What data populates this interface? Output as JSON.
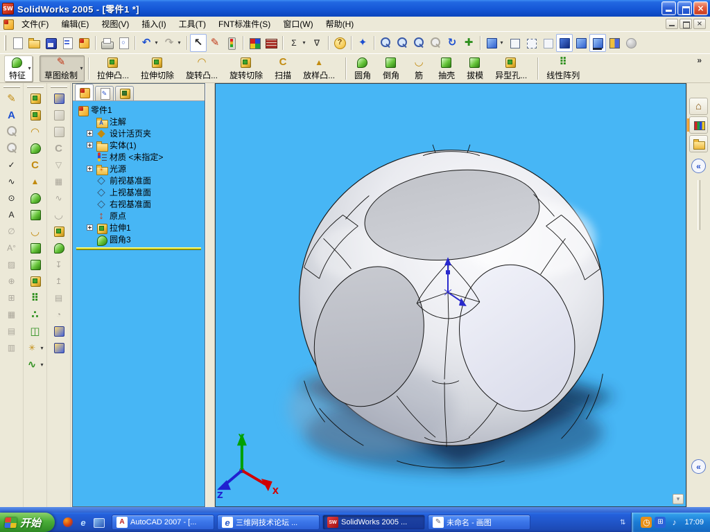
{
  "titlebar": {
    "logo": "SW",
    "title": "SolidWorks 2005 - [零件1 *]",
    "controls": [
      {
        "name": "minimize-button",
        "c": "wmin"
      },
      {
        "name": "restore-button",
        "c": "wres"
      },
      {
        "name": "close-button",
        "c": "wclose",
        "g": "×"
      }
    ]
  },
  "menubar": {
    "items": [
      "文件(F)",
      "编辑(E)",
      "视图(V)",
      "插入(I)",
      "工具(T)",
      "FNT标准件(S)",
      "窗口(W)",
      "帮助(H)"
    ],
    "controls": [
      {
        "name": "child-minimize-button",
        "c": "wmin"
      },
      {
        "name": "child-restore-button",
        "c": "wres"
      },
      {
        "name": "child-close-button",
        "c": "wclose",
        "g": "×"
      }
    ]
  },
  "std_toolbar": {
    "items": [
      {
        "name": "new-button",
        "icon": "new-document-icon",
        "c": "pg"
      },
      {
        "name": "open-button",
        "icon": "open-folder-icon",
        "c": "foldic"
      },
      {
        "name": "save-button",
        "icon": "save-icon",
        "c": "dsk"
      },
      {
        "name": "make-drawing-button",
        "icon": "make-drawing-icon",
        "c": "pg pgd"
      },
      {
        "name": "make-assembly-button",
        "icon": "make-assembly-icon",
        "c": "chip-sw"
      },
      {
        "sep": "on"
      },
      {
        "name": "print-button",
        "icon": "print-icon",
        "c": "prn"
      },
      {
        "name": "print-preview-button",
        "icon": "print-preview-icon",
        "c": "pg",
        "g": "○"
      },
      {
        "sep": "on"
      },
      {
        "name": "undo-button",
        "icon": "undo-icon",
        "g": "↶",
        "c": "c-blue big",
        "drop": "on"
      },
      {
        "name": "redo-button",
        "icon": "redo-icon",
        "g": "↷",
        "c": "c-dis big",
        "drop": "on"
      },
      {
        "sep": "on"
      },
      {
        "name": "select-button",
        "icon": "select-arrow-icon",
        "g": "↖",
        "c": "c-dark big",
        "state": "pressed"
      },
      {
        "name": "sketch-button",
        "icon": "sketch-pencil-icon",
        "g": "✎",
        "c": "c-red big"
      },
      {
        "name": "rebuild-button",
        "icon": "rebuild-traffic-light-icon",
        "c": "traffic"
      },
      {
        "sep": "on"
      },
      {
        "name": "edit-color-button",
        "icon": "color-palette-icon",
        "c": "pal"
      },
      {
        "name": "texture-button",
        "icon": "texture-bricks-icon",
        "c": "brk"
      },
      {
        "sep": "on"
      },
      {
        "name": "measure-button",
        "icon": "measure-sigma-icon",
        "g": "Σ",
        "c": "c-dark",
        "drop": "on"
      },
      {
        "name": "selection-filter-button",
        "icon": "selection-filter-icon",
        "g": "∇",
        "c": "c-dark"
      },
      {
        "sep": "on"
      },
      {
        "name": "help-button",
        "icon": "help-icon",
        "g": "?",
        "c": "hlp"
      },
      {
        "sep": "on"
      },
      {
        "name": "view-orientation-button",
        "icon": "view-orientation-icon",
        "g": "✦",
        "c": "c-blue big"
      },
      {
        "sep": "on"
      },
      {
        "name": "zoom-in-out-button",
        "icon": "zoom-in-out-icon",
        "c": "mag"
      },
      {
        "name": "zoom-area-button",
        "icon": "zoom-area-icon",
        "c": "mag"
      },
      {
        "name": "zoom-to-selection-button",
        "icon": "zoom-selection-icon",
        "c": "mag"
      },
      {
        "name": "zoom-to-fit-button",
        "icon": "zoom-fit-icon",
        "c": "mag dis"
      },
      {
        "name": "rotate-view-button",
        "icon": "rotate-view-icon",
        "g": "↻",
        "c": "c-blue big"
      },
      {
        "name": "pan-button",
        "icon": "pan-icon",
        "g": "✚",
        "c": "c-green big"
      },
      {
        "sep": "on"
      },
      {
        "name": "standard-views-button",
        "icon": "standard-views-cube-icon",
        "c": "cube-b",
        "drop": "on"
      },
      {
        "name": "wireframe-button",
        "icon": "wireframe-cube-icon",
        "c": "cube-w"
      },
      {
        "name": "hidden-lines-visible-button",
        "icon": "hidden-lines-visible-icon",
        "c": "cube-w hl"
      },
      {
        "name": "hidden-lines-removed-button",
        "icon": "hidden-lines-removed-icon",
        "c": "cube-w hr"
      },
      {
        "name": "shaded-with-edges-button",
        "icon": "shaded-with-edges-icon",
        "c": "cube-b dark",
        "state": "pressed"
      },
      {
        "name": "shaded-button",
        "icon": "shaded-icon",
        "c": "cube-b"
      },
      {
        "name": "shadows-button",
        "icon": "shadows-icon",
        "c": "cube-b shd",
        "state": "pressed"
      },
      {
        "name": "section-view-button",
        "icon": "section-view-icon",
        "c": "cube-sec"
      },
      {
        "name": "disabled-tool-button",
        "icon": "disabled-sphere-icon",
        "c": "ball-dis"
      }
    ]
  },
  "feat_toolbar": {
    "overflow": "»",
    "buttons": [
      {
        "name": "features-button",
        "icon": "features-icon",
        "c": "chip-g rnd",
        "label": "特征",
        "drop": "on",
        "state": "raised"
      },
      {
        "name": "sketch-draw-button",
        "icon": "sketch-pencil-icon",
        "g": "✎",
        "c": "c-red big",
        "label": "草图绘制",
        "drop": "on",
        "state": "pressed"
      },
      {
        "sep": "on"
      },
      {
        "name": "extrude-boss-button",
        "icon": "extrude-boss-icon",
        "c": "chip-y",
        "label": "拉伸凸..."
      },
      {
        "name": "extrude-cut-button",
        "icon": "extrude-cut-icon",
        "c": "chip-y",
        "label": "拉伸切除"
      },
      {
        "name": "revolve-boss-button",
        "icon": "revolve-boss-icon",
        "g": "◠",
        "c": "c-gold big",
        "label": "旋转凸..."
      },
      {
        "name": "revolve-cut-button",
        "icon": "revolve-cut-icon",
        "c": "chip-y",
        "label": "旋转切除"
      },
      {
        "name": "sweep-button",
        "icon": "sweep-icon",
        "g": "C",
        "c": "c-gold big",
        "label": "扫描"
      },
      {
        "name": "loft-button",
        "icon": "loft-icon",
        "g": "▲",
        "c": "c-gold",
        "label": "放样凸..."
      },
      {
        "sep": "on"
      },
      {
        "name": "fillet-button",
        "icon": "fillet-icon",
        "c": "chip-g rnd",
        "label": "圆角"
      },
      {
        "name": "chamfer-button",
        "icon": "chamfer-icon",
        "c": "chip-g",
        "label": "倒角"
      },
      {
        "name": "rib-button",
        "icon": "rib-icon",
        "g": "◡",
        "c": "c-gold big",
        "label": "筋"
      },
      {
        "name": "shell-button",
        "icon": "shell-icon",
        "c": "chip-g",
        "label": "抽壳"
      },
      {
        "name": "draft-button",
        "icon": "draft-icon",
        "c": "chip-g",
        "label": "拔模"
      },
      {
        "name": "hole-wizard-button",
        "icon": "hole-wizard-icon",
        "c": "chip-y",
        "label": "异型孔..."
      },
      {
        "sep": "on"
      },
      {
        "name": "linear-pattern-button",
        "icon": "linear-pattern-icon",
        "g": "⠿",
        "c": "c-green big",
        "label": "线性阵列"
      }
    ]
  },
  "left_tools": {
    "col1": [
      {
        "n": "sketch-tool-icon",
        "g": "✎",
        "c": "c-gold big"
      },
      {
        "n": "note-icon",
        "g": "A",
        "c": "c-blue big"
      },
      {
        "n": "zoom-tool-icon",
        "c": "mag dis"
      },
      {
        "n": "zoom-area-tool-icon",
        "c": "mag dis"
      },
      {
        "n": "smart-dimension-icon",
        "g": "✓",
        "c": "c-dark"
      },
      {
        "n": "model-items-icon",
        "g": "∿",
        "c": "c-dark"
      },
      {
        "n": "detail-circle-icon",
        "g": "⊙",
        "c": "c-dark"
      },
      {
        "n": "datum-target-icon",
        "g": "A",
        "c": "c-dark"
      },
      {
        "n": "surface-finish-icon",
        "g": "∅",
        "c": "c-dis"
      },
      {
        "n": "geometric-tolerance-icon",
        "g": "A°",
        "c": "c-dis"
      },
      {
        "n": "area-hatch-icon",
        "g": "▨",
        "c": "c-dis"
      },
      {
        "n": "center-mark-icon",
        "g": "⊕",
        "c": "c-dis"
      },
      {
        "n": "dowel-symbol-icon",
        "g": "⊞",
        "c": "c-dis"
      },
      {
        "n": "balloon-icon",
        "g": "▦",
        "c": "c-dis"
      },
      {
        "n": "weld-symbol-icon",
        "g": "▤",
        "c": "c-dis"
      },
      {
        "n": "table-icon",
        "g": "▥",
        "c": "c-dis"
      }
    ],
    "col2": [
      {
        "n": "extrude-boss-icon",
        "c": "chip-y"
      },
      {
        "n": "extruded-cut-icon",
        "c": "chip-y"
      },
      {
        "n": "revolve-icon",
        "g": "◠",
        "c": "c-gold big"
      },
      {
        "n": "dome-icon",
        "c": "chip-g rnd"
      },
      {
        "n": "sweep-icon",
        "g": "C",
        "c": "c-gold big"
      },
      {
        "n": "loft-icon",
        "g": "▲",
        "c": "c-gold"
      },
      {
        "n": "fillet-icon",
        "c": "chip-g rnd"
      },
      {
        "n": "chamfer-icon",
        "c": "chip-g"
      },
      {
        "n": "rib-icon",
        "g": "◡",
        "c": "c-gold big"
      },
      {
        "n": "shell-icon",
        "c": "chip-g"
      },
      {
        "n": "draft-icon",
        "c": "chip-g"
      },
      {
        "n": "hole-wizard-icon",
        "c": "chip-y"
      },
      {
        "n": "linear-pattern-icon",
        "g": "⠿",
        "c": "c-green big"
      },
      {
        "n": "circular-pattern-icon",
        "g": "∴",
        "c": "c-green big"
      },
      {
        "n": "mirror-icon",
        "g": "◫",
        "c": "c-green big"
      },
      {
        "n": "sketch-entities-icon",
        "g": "✳",
        "c": "c-gold",
        "drop": "on"
      },
      {
        "n": "spline-icon",
        "g": "∿",
        "c": "c-green big",
        "drop": "on"
      }
    ],
    "col3": [
      {
        "n": "wrap-icon",
        "c": "chip-b"
      },
      {
        "n": "loft-cut-icon",
        "c": "chip-dis"
      },
      {
        "n": "boundary-icon",
        "c": "chip-dis"
      },
      {
        "n": "sweep-cut-icon",
        "g": "C",
        "c": "c-dis big"
      },
      {
        "n": "thicken-icon",
        "g": "▽",
        "c": "c-dis"
      },
      {
        "n": "pattern-table-icon",
        "g": "▦",
        "c": "c-dis"
      },
      {
        "n": "curve-icon",
        "g": "∿",
        "c": "c-dis"
      },
      {
        "n": "scoop-icon",
        "g": "◡",
        "c": "c-dis big"
      },
      {
        "n": "cut-with-surface-icon",
        "c": "chip-y"
      },
      {
        "n": "combine-icon",
        "c": "chip-g rnd"
      },
      {
        "n": "move-face-icon",
        "g": "↧",
        "c": "c-dis"
      },
      {
        "n": "delete-face-icon",
        "g": "↥",
        "c": "c-dis"
      },
      {
        "n": "replace-face-icon",
        "g": "▤",
        "c": "c-dis"
      },
      {
        "n": "untrim-surface-icon",
        "g": "◔",
        "c": "c-dis"
      },
      {
        "n": "flex-icon",
        "c": "chip-b"
      },
      {
        "n": "deform-icon",
        "c": "chip-b"
      }
    ]
  },
  "feature_manager": {
    "tabs": [
      {
        "name": "tab-featuremanager",
        "icon": "featuremanager-tab-icon",
        "c": "chip-sw",
        "active": "on"
      },
      {
        "name": "tab-propertymanager",
        "icon": "propertymanager-tab-icon",
        "g": "✎",
        "c": "pg"
      },
      {
        "name": "tab-configurationmanager",
        "icon": "configurationmanager-tab-icon",
        "g": "≡",
        "c": "chip-y"
      }
    ],
    "items": [
      {
        "name": "tree-item-part",
        "icon": "part-icon",
        "c": "chip-sw",
        "label": "零件1",
        "rootc": "rt"
      },
      {
        "name": "tree-item-annotations",
        "icon": "annotations-folder-icon",
        "g": "A",
        "c": "foldic fga",
        "label": "注解"
      },
      {
        "name": "tree-item-design-binder",
        "icon": "design-binder-icon",
        "g": "◆",
        "c": "c-gold big",
        "label": "设计活页夹",
        "exp": "on"
      },
      {
        "name": "tree-item-solids",
        "icon": "solid-bodies-folder-icon",
        "c": "foldic",
        "label": "实体(1)",
        "exp": "on"
      },
      {
        "name": "tree-item-material",
        "icon": "material-icon",
        "c": "mat",
        "label": "材质 <未指定>"
      },
      {
        "name": "tree-item-lights",
        "icon": "lights-folder-icon",
        "g": "☀",
        "c": "foldic fsun",
        "label": "光源",
        "exp": "on"
      },
      {
        "name": "tree-item-front-plane",
        "icon": "front-plane-icon",
        "g": "◇",
        "c": "c-slate big",
        "label": "前视基准面"
      },
      {
        "name": "tree-item-top-plane",
        "icon": "top-plane-icon",
        "g": "◇",
        "c": "c-slate big",
        "label": "上视基准面"
      },
      {
        "name": "tree-item-right-plane",
        "icon": "right-plane-icon",
        "g": "◇",
        "c": "c-slate big",
        "label": "右视基准面"
      },
      {
        "name": "tree-item-origin",
        "icon": "origin-icon",
        "g": "↕",
        "c": "c-red big",
        "label": "原点"
      },
      {
        "name": "tree-item-extrude1",
        "icon": "extrude1-icon",
        "c": "chip-y",
        "label": "拉伸1",
        "exp": "on"
      },
      {
        "name": "tree-item-fillet3",
        "icon": "fillet3-icon",
        "c": "chip-g rnd",
        "label": "圆角3"
      }
    ]
  },
  "task_pane": {
    "collapse_glyph": "«",
    "chevron_glyph": "▾",
    "items": [
      {
        "name": "solidworks-resources-tab",
        "icon": "home-icon",
        "g": "⌂",
        "c": "c-brown big"
      },
      {
        "name": "design-library-tab",
        "icon": "design-library-icon",
        "c": "lib",
        "active": "on"
      },
      {
        "name": "file-explorer-tab",
        "icon": "file-explorer-icon",
        "c": "foldic"
      }
    ]
  },
  "taskbar": {
    "start": "开始",
    "collapse_glyph": "⇅",
    "time": "17:09",
    "quick_launch": [
      {
        "n": "media-player-icon",
        "c": "qlwmp"
      },
      {
        "n": "internet-explorer-icon",
        "g": "e",
        "c": "qlie"
      },
      {
        "n": "show-desktop-icon",
        "c": "qldesk"
      }
    ],
    "tasks": [
      {
        "name": "task-autocad",
        "icon": "autocad-icon",
        "g": "A",
        "c": "tkacad",
        "label": "AutoCAD 2007 - [..."
      },
      {
        "name": "task-browser-forum",
        "icon": "ie-page-icon",
        "g": "e",
        "c": "tkpage",
        "label": "三维网技术论坛 ..."
      },
      {
        "name": "task-solidworks",
        "icon": "solidworks-task-icon",
        "g": "SW",
        "c": "tksw",
        "label": "SolidWorks 2005 ...",
        "state": "tkon"
      },
      {
        "name": "task-paint",
        "icon": "paint-icon",
        "g": "✎",
        "c": "tkpaint",
        "label": "未命名 - 画图"
      }
    ],
    "tray": [
      {
        "n": "clock-tray-icon",
        "g": "◷",
        "c": "trclock"
      },
      {
        "n": "network-tray-icon",
        "g": "⊞",
        "c": "trnet"
      },
      {
        "n": "volume-tray-icon",
        "g": "♪",
        "c": "trvol"
      }
    ]
  }
}
